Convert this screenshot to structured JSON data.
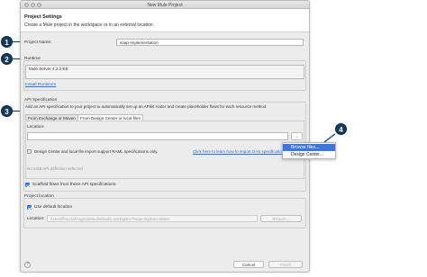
{
  "window": {
    "title": "New Mule Project"
  },
  "header": {
    "title": "Project Settings",
    "description": "Create a Mule project in the workspace or in an external location."
  },
  "project_name": {
    "label": "Project Name:",
    "value": "soap-implementation"
  },
  "runtime": {
    "group_label": "Runtime",
    "selected": "Mule Server 4.2.2 EE",
    "install_link": "Install Runtimes"
  },
  "api_spec": {
    "group_label": "API Specification",
    "description": "Add an API specification to your project to automatically set up an APIkit router and create placeholder flows for each resource method",
    "tabs": [
      {
        "label": "From Exchange or Maven"
      },
      {
        "label": "From Design Center or local files"
      }
    ],
    "location_label": "Location:",
    "location_value": "",
    "browse_button": "...",
    "note_text": "Design Center and local file import support RAML specifications only.",
    "note_link": "Click here to learn how to import OAS specifications",
    "status": "No valid API definition selected",
    "scaffold_label": "Scaffold flows from these API specifications",
    "scaffold_checked": true
  },
  "project_location": {
    "group_label": "Project location",
    "use_default_label": "Use default location",
    "use_default_checked": true,
    "location_label": "Location:",
    "location_value": "/Users/fmuzza/AnypointStudio/studio-workspace7/soap-implementation",
    "browse_button": "Browse..."
  },
  "footer": {
    "help": "?",
    "cancel": "Cancel",
    "finish": "Finish"
  },
  "menu": {
    "items": [
      "Browse files...",
      "Design Center..."
    ]
  },
  "callouts": [
    "1",
    "2",
    "3",
    "4"
  ],
  "colors": {
    "callout": "#123a5a",
    "link": "#2a6bd6",
    "menu_highlight": "#3c78d8"
  }
}
